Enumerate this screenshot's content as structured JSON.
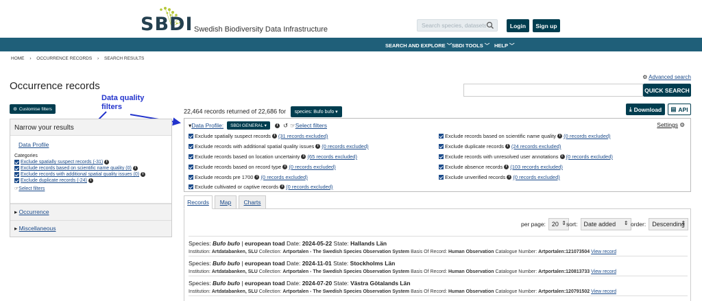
{
  "header": {
    "logo_text": "SBDI",
    "subtitle": "Swedish Biodiversity Data Infrastructure",
    "search_placeholder": "Search species, datasets",
    "login_label": "Login",
    "signup_label": "Sign up"
  },
  "nav": {
    "items": [
      "SEARCH AND EXPLORE ﹀",
      "SBDI TOOLS ﹀",
      "HELP ﹀"
    ]
  },
  "breadcrumb": [
    "HOME",
    "›",
    "OCCURRENCE RECORDS",
    "›",
    "SEARCH RESULTS"
  ],
  "page": {
    "title": "Occurrence records",
    "advanced_search": "Advanced search",
    "quick_search_label": "QUICK SEARCH",
    "customise_label": "Customise filters",
    "annotation": "Data quality filters"
  },
  "sidebar": {
    "heading": "Narrow your results",
    "profile_title": "Data Profile",
    "categories_label": "Categories",
    "categories": [
      "Exclude spatially suspect records (-31)",
      "Exclude records based on scientific name quality (0)",
      "Exclude records with additional spatial quality issues (0)",
      "Exclude duplicate records (-24)"
    ],
    "select_filters": "Select filters",
    "sections": [
      "Occurrence",
      "Miscellaneous"
    ]
  },
  "results": {
    "count_text": "22,464 records returned of 22,686 for",
    "species_filter": "species: Bufo bufo",
    "download_label": "Download",
    "api_label": "API"
  },
  "dq": {
    "label": "Data Profile:",
    "profile": "SBDI GENERAL",
    "select_filters": "Select filters",
    "settings": "Settings",
    "left": [
      {
        "text": "Exclude spatially suspect records",
        "excl": "(31 records excluded)"
      },
      {
        "text": "Exclude records with additional spatial quality issues",
        "excl": "(0 records excluded)"
      },
      {
        "text": "Exclude records based on location uncertainty",
        "excl": "(65 records excluded)"
      },
      {
        "text": "Exclude records based on record type",
        "excl": "(0 records excluded)"
      },
      {
        "text": "Exclude records pre 1700",
        "excl": "(0 records excluded)"
      },
      {
        "text": "Exclude cultivated or captive records",
        "excl": "(0 records excluded)"
      }
    ],
    "right": [
      {
        "text": "Exclude records based on scientific name quality",
        "excl": "(0 records excluded)"
      },
      {
        "text": "Exclude duplicate records",
        "excl": "(24 records excluded)"
      },
      {
        "text": "Exclude records with unresolved user annotations",
        "excl": "(0 records excluded)"
      },
      {
        "text": "Exclude absence records",
        "excl": "(103 records excluded)"
      },
      {
        "text": "Exclude unverified records",
        "excl": "(0 records excluded)"
      }
    ]
  },
  "tabs": [
    "Records",
    "Map",
    "Charts"
  ],
  "controls": {
    "per_page_label": "per page:",
    "per_page": "20",
    "sort_label": "sort:",
    "sort": "Date added",
    "order_label": "order:",
    "order": "Descending"
  },
  "records": [
    {
      "species": "Bufo bufo",
      "common": "european toad",
      "date": "2024-05-22",
      "state": "Hallands Län",
      "institution": "Artdatabanken, SLU",
      "collection": "Artportalen - The Swedish Species Observation System",
      "basis": "Human Observation",
      "catalogue": "Artportalen:121073504"
    },
    {
      "species": "Bufo bufo",
      "common": "european toad",
      "date": "2024-11-01",
      "state": "Stockholms Län",
      "institution": "Artdatabanken, SLU",
      "collection": "Artportalen - The Swedish Species Observation System",
      "basis": "Human Observation",
      "catalogue": "Artportalen:120813733"
    },
    {
      "species": "Bufo bufo",
      "common": "european toad",
      "date": "2024-07-20",
      "state": "Västra Götalands Län",
      "institution": "Artdatabanken, SLU",
      "collection": "Artportalen - The Swedish Species Observation System",
      "basis": "Human Observation",
      "catalogue": "Artportalen:120791502"
    }
  ],
  "record_labels": {
    "species": "Species:",
    "date": "Date:",
    "state": "State:",
    "institution": "Institution:",
    "collection": "Collection:",
    "basis": "Basis Of Record:",
    "catalogue": "Catalogue Number:",
    "view": "View record"
  },
  "colors": {
    "primary_dark": "#003d4f",
    "nav": "#1f5f79",
    "annotation": "#2233cc"
  }
}
